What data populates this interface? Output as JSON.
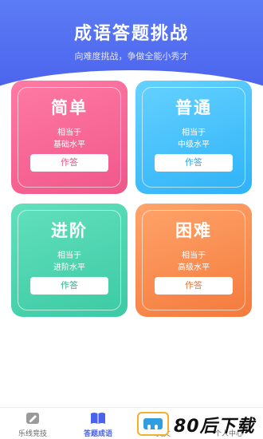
{
  "header": {
    "title": "成语答题挑战",
    "subtitle": "向难度挑战，争做全能小秀才"
  },
  "cards": [
    {
      "title": "简单",
      "line1": "相当于",
      "line2": "基础水平",
      "button": "作答",
      "color": "#f0578a"
    },
    {
      "title": "普通",
      "line1": "相当于",
      "line2": "中级水平",
      "button": "作答",
      "color": "#2fb2f7"
    },
    {
      "title": "进阶",
      "line1": "相当于",
      "line2": "进阶水平",
      "button": "作答",
      "color": "#3ccaa4"
    },
    {
      "title": "困难",
      "line1": "相当于",
      "line2": "高级水平",
      "button": "作答",
      "color": "#f47a3c"
    }
  ],
  "tabbar": {
    "items": [
      {
        "label": "乐线竞技",
        "icon": "edit-icon",
        "active": false
      },
      {
        "label": "答题成语",
        "icon": "book-icon",
        "active": true
      },
      {
        "label": "美文",
        "icon": "article-icon",
        "active": false
      },
      {
        "label": "个人中心",
        "icon": "person-icon",
        "active": false
      }
    ]
  },
  "watermark": {
    "text": "80后下载"
  }
}
